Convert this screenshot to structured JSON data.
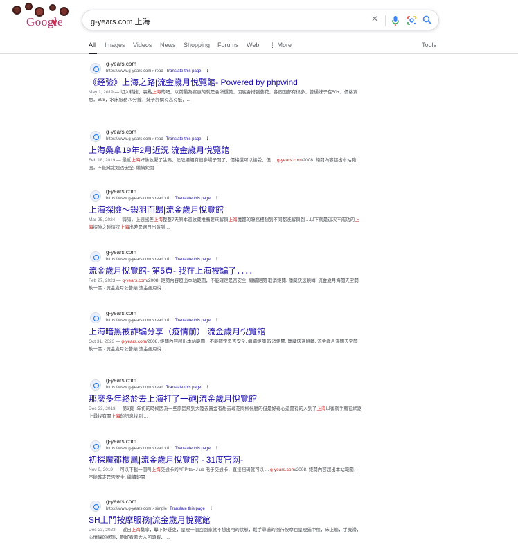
{
  "logo": {
    "text": "Google"
  },
  "search": {
    "query": "g-years.com 上海"
  },
  "tabs": [
    "All",
    "Images",
    "Videos",
    "News",
    "Shopping",
    "Forums",
    "Web",
    "More",
    "Tools"
  ],
  "results": [
    {
      "site": "g-years.com",
      "url": "https://www.g-years.com › read",
      "translate": "Translate this page",
      "title": "《经验》上海之路|流金歲月悅覽館- Powered by phpwind",
      "date": "May 1, 2019",
      "snippet": [
        {
          "t": " — 切入精搜，裏點"
        },
        {
          "t": "上海",
          "h": true
        },
        {
          "t": "的吧，以前最為實惠的就是會所選美，因底會搭腦藝花，各個面部有很多，普通妹子在50+，價格實惠，698，水床服務70分鐘，妹子評價有高有低，..."
        }
      ]
    },
    {
      "site": "g-years.com",
      "url": "https://www.g-years.com › read",
      "translate": "Translate this page",
      "title": "上海桑拿19年2月近況|流金歲月悅覽館",
      "date": "Feb 18, 2019",
      "snippet": [
        {
          "t": " — 最近"
        },
        {
          "t": "上海",
          "h": true
        },
        {
          "t": "好像收緊了生嗎，陸陸續續有很多場子開了，價格還可以接受，但 ... "
        },
        {
          "t": "g-years.com",
          "h": true
        },
        {
          "t": "/2008. 鉅閱內容超出本站範圍，不能確定是否安全. 繼續鉅閱"
        }
      ]
    },
    {
      "site": "g-years.com",
      "url": "https://www.g-years.com › read › ti...",
      "translate": "Translate this page",
      "title": "上海探險～鎩羽而歸|流金歲月悅覽館",
      "date": "Mar 25, 2024",
      "snippet": [
        {
          "t": " — 嗨嗨，上週出差"
        },
        {
          "t": "上海",
          "h": true
        },
        {
          "t": "整整7天原本還收藏推薦要來解鎖"
        },
        {
          "t": "上海",
          "h": true
        },
        {
          "t": "魔都的瞭高樓想到不同都洗解鎖到 ...以下就是這次不成功的"
        },
        {
          "t": "上海",
          "h": true
        },
        {
          "t": "探險之碰這次"
        },
        {
          "t": "上海",
          "h": true
        },
        {
          "t": "出差是週日出發到 ..."
        }
      ]
    },
    {
      "site": "g-years.com",
      "url": "https://www.g-years.com › read › ti...",
      "translate": "Translate this page",
      "title": "流金歲月悅覽館- 第5頁- 我在上海被騙了．．．．",
      "date": "Feb 27, 2023",
      "snippet": [
        {
          "t": " — "
        },
        {
          "t": "g-years.com",
          "h": true
        },
        {
          "t": "/2008. 鉅閱內容超出本站範圍，不能確定是否安全. 繼續鉅閱 取消鉅閱. 隱藏快速跳轉. 流金歲月海闊天空開放一區 · 流金歲月公告類 流金歲月悅 ..."
        }
      ]
    },
    {
      "site": "g-years.com",
      "url": "https://www.g-years.com › read › ti...",
      "translate": "Translate this page",
      "title": "上海暗黑被詐騙分享（疫情前）|流金歲月悅覽館",
      "date": "Oct 31, 2023",
      "snippet": [
        {
          "t": " — "
        },
        {
          "t": "g-years.com",
          "h": true
        },
        {
          "t": "/2008. 鉅閱內容超出本站範圍，不能確定是否安全. 繼續鉅閱 取消鉅閱. 隱藏快速跳轉. 流金歲月海闊天空開放一區 · 流金歲月公告類 流金歲月悅 ..."
        }
      ]
    },
    {
      "site": "g-years.com",
      "url": "https://www.g-years.com › read",
      "translate": "Translate this page",
      "title": "那麼多年終於去上海打了一砲|流金歲月悅覽館",
      "date": "Dec 23, 2018",
      "snippet": [
        {
          "t": " — 第3頁- 年初的時候因為一些原因飛到大陸去買金有想去尋花問柳什麼的但是好奇心還是有的入到了"
        },
        {
          "t": "上海",
          "h": true
        },
        {
          "t": "以後就手賤在網路上尋找有關"
        },
        {
          "t": "上海",
          "h": true
        },
        {
          "t": "的訊息找到 ..."
        }
      ]
    },
    {
      "site": "g-years.com",
      "url": "https://www.g-years.com › read › ti...",
      "translate": "Translate this page",
      "title": "初探魔都樓鳳|流金歲月悅覽館 - 31度官网-",
      "date": "Nov 9, 2019",
      "snippet": [
        {
          "t": " — 可以下載一個叫"
        },
        {
          "t": "上海",
          "h": true
        },
        {
          "t": "交通卡的APP taHJ ub 电子交通卡，直接扫码就可以 ... "
        },
        {
          "t": "g-years.com",
          "h": true
        },
        {
          "t": "/2008. 鉅閱內容超出本站範圍，不能確定是否安全. 繼續鉅閱"
        }
      ]
    },
    {
      "site": "g-years.com",
      "url": "https://www.g-years.com › simple",
      "translate": "Translate this page",
      "title": "SH上門按摩服務|流金歲月悅覽館",
      "date": "Dec 23, 2023",
      "snippet": [
        {
          "t": " — 近日"
        },
        {
          "t": "上海",
          "h": true
        },
        {
          "t": "桑拿，擊下好疑吏，呈現一個回到家就不想出門的狀態，鬆手尋過的例行按摩也呈現猶中程，床上躺，手機滑，心情偉的狀態，剛好看著大人回頭客， ..."
        }
      ]
    }
  ]
}
